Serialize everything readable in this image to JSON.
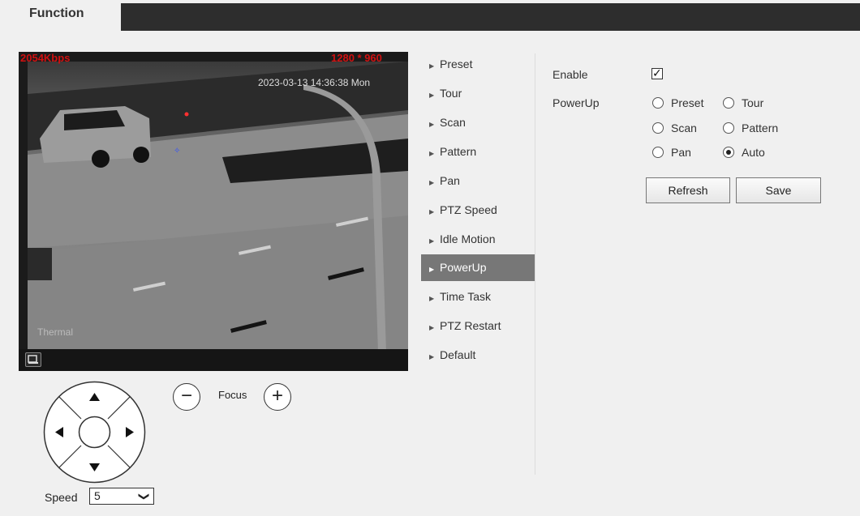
{
  "tabs": {
    "function": "Function"
  },
  "video": {
    "bitrate": "2054Kbps",
    "resolution": "1280 * 960",
    "timestamp": "2023-03-13 14:36:38 Mon",
    "channel": "Thermal"
  },
  "ptz": {
    "focus_label": "Focus",
    "focus_minus": "−",
    "focus_plus": "+",
    "speed_label": "Speed",
    "speed_value": "5",
    "speed_chevron": "❯"
  },
  "menu": {
    "items": [
      {
        "label": "Preset"
      },
      {
        "label": "Tour"
      },
      {
        "label": "Scan"
      },
      {
        "label": "Pattern"
      },
      {
        "label": "Pan"
      },
      {
        "label": "PTZ Speed"
      },
      {
        "label": "Idle Motion"
      },
      {
        "label": "PowerUp",
        "active": true
      },
      {
        "label": "Time Task"
      },
      {
        "label": "PTZ Restart"
      },
      {
        "label": "Default"
      }
    ]
  },
  "settings": {
    "enable_label": "Enable",
    "enable_checked": true,
    "enable_check_glyph": "✓",
    "powerup_label": "PowerUp",
    "options": [
      {
        "label": "Preset",
        "checked": false
      },
      {
        "label": "Tour",
        "checked": false
      },
      {
        "label": "Scan",
        "checked": false
      },
      {
        "label": "Pattern",
        "checked": false
      },
      {
        "label": "Pan",
        "checked": false
      },
      {
        "label": "Auto",
        "checked": true
      }
    ],
    "refresh_label": "Refresh",
    "save_label": "Save"
  },
  "colors": {
    "topbar": "#2d2d2d",
    "active_menu": "#777777",
    "overlay_red": "#d01010"
  }
}
